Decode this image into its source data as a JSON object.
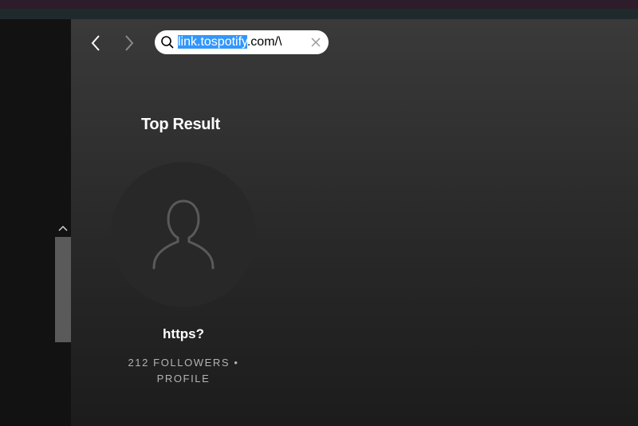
{
  "search": {
    "selected_text": "link.tospotify",
    "rest_text": ".com/\\"
  },
  "top_result": {
    "heading": "Top Result",
    "name": "https?",
    "meta_line1": "212 FOLLOWERS •",
    "meta_line2": "PROFILE"
  },
  "icons": {
    "back": "chevron-left-icon",
    "forward": "chevron-right-icon",
    "search": "search-icon",
    "clear": "close-icon",
    "avatar": "user-silhouette-icon",
    "scroll_up": "chevron-up-icon"
  },
  "colors": {
    "background": "#121212",
    "main_top": "#3a3a3a",
    "avatar_bg": "#282828",
    "selection": "#3297fd",
    "meta_text": "#b3b3b3"
  }
}
